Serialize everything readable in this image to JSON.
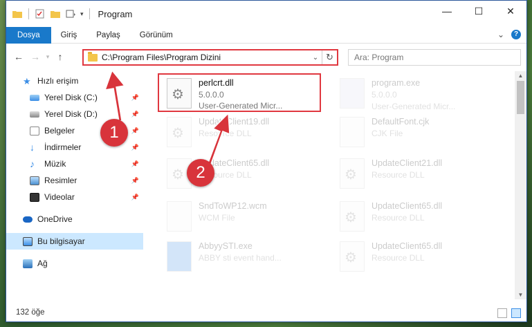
{
  "window": {
    "title": "Program"
  },
  "ribbon": {
    "tabs": [
      "Dosya",
      "Giriş",
      "Paylaş",
      "Görünüm"
    ]
  },
  "address": {
    "path": "C:\\Program Files\\Program Dizini"
  },
  "search": {
    "placeholder": "Ara: Program"
  },
  "sidebar": {
    "items": [
      {
        "label": "Hızlı erişim",
        "icon": "star-icon"
      },
      {
        "label": "Yerel Disk (C:)",
        "icon": "drive-icon"
      },
      {
        "label": "Yerel Disk (D:)",
        "icon": "drive-icon"
      },
      {
        "label": "Belgeler",
        "icon": "documents-icon"
      },
      {
        "label": "İndirmeler",
        "icon": "download-icon"
      },
      {
        "label": "Müzik",
        "icon": "music-icon"
      },
      {
        "label": "Resimler",
        "icon": "pictures-icon"
      },
      {
        "label": "Videolar",
        "icon": "video-icon"
      },
      {
        "label": "OneDrive",
        "icon": "cloud-icon"
      },
      {
        "label": "Bu bilgisayar",
        "icon": "computer-icon"
      },
      {
        "label": "Ağ",
        "icon": "network-icon"
      }
    ]
  },
  "files": [
    {
      "name": "perlcrt.dll",
      "line2": "5.0.0.0",
      "line3": "User-Generated Micr..."
    },
    {
      "name": "program.exe",
      "line2": "5.0.0.0",
      "line3": "User-Generated Micr..."
    },
    {
      "name": "UpdateClient19.dll",
      "line2": "Resource DLL"
    },
    {
      "name": "DefaultFont.cjk",
      "line2": "CJK File"
    },
    {
      "name": "UpdateClient65.dll",
      "line2": "Resource DLL"
    },
    {
      "name": "UpdateClient21.dll",
      "line2": "Resource DLL"
    },
    {
      "name": "SndToWP12.wcm",
      "line2": "WCM File"
    },
    {
      "name": "UpdateClient65.dll",
      "line2": "Resource DLL"
    },
    {
      "name": "AbbyySTI.exe",
      "line2": "ABBY sti event hand..."
    },
    {
      "name": "UpdateClient65.dll",
      "line2": "Resource DLL"
    }
  ],
  "status": {
    "count": "132 öğe"
  },
  "annotations": {
    "step1": "1",
    "step2": "2",
    "color": "#d8343b"
  }
}
